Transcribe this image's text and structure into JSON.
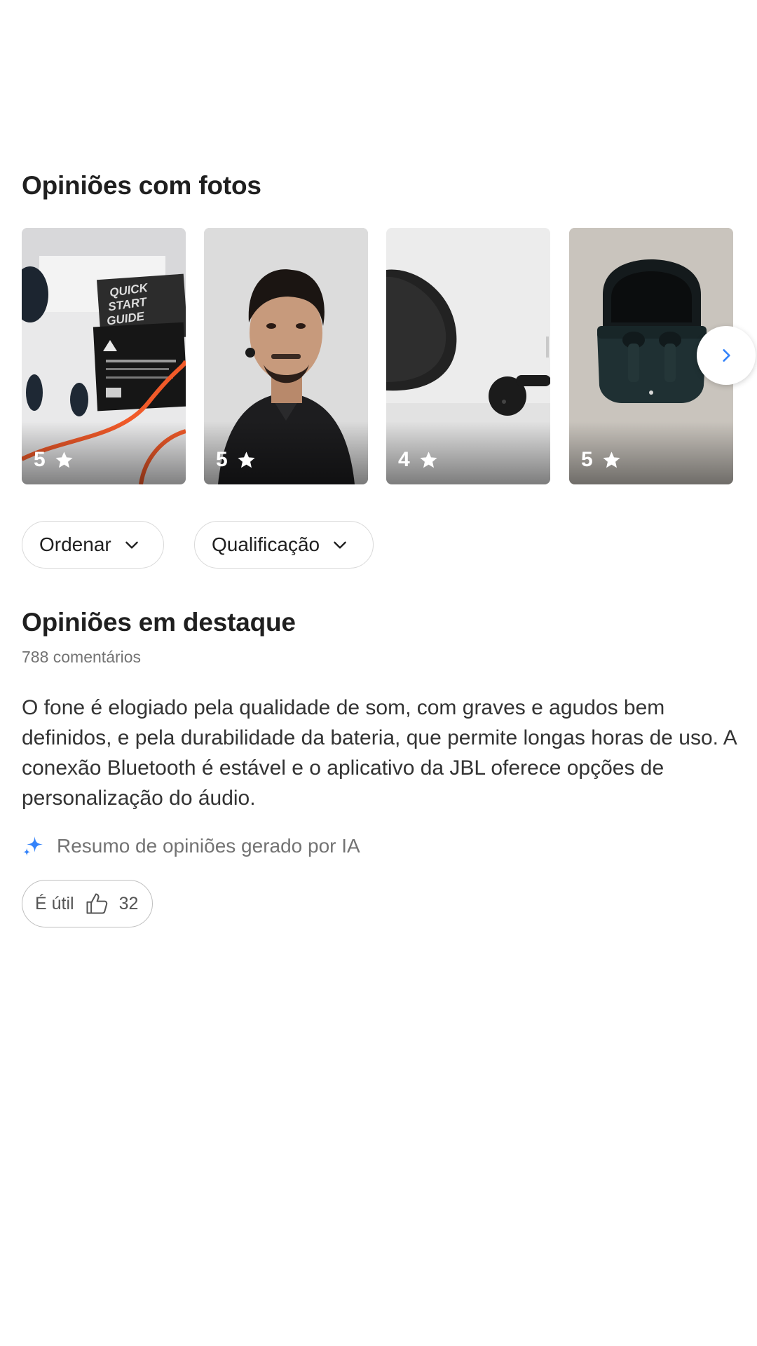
{
  "photos_section": {
    "title": "Opiniões com fotos",
    "photos": [
      {
        "rating": "5",
        "subject": "earbuds with box and quick start guide"
      },
      {
        "rating": "5",
        "subject": "man wearing earbud"
      },
      {
        "rating": "4",
        "subject": "earbud and charging case close-up"
      },
      {
        "rating": "5",
        "subject": "open charging case with earbuds"
      }
    ],
    "next_icon": "chevron-right-icon"
  },
  "filters": {
    "sort_label": "Ordenar",
    "rating_label": "Qualificação"
  },
  "highlights": {
    "title": "Opiniões em destaque",
    "comment_count": "788 comentários",
    "summary": "O fone é elogiado pela qualidade de som, com graves e agudos bem definidos, e pela durabilidade da bateria, que permite longas horas de uso. A conexão Bluetooth é estável e o aplicativo da JBL oferece opções de personalização do áudio.",
    "ai_note": "Resumo de opiniões gerado por IA",
    "helpful_label": "É útil",
    "helpful_count": "32"
  },
  "colors": {
    "accent": "#3483fa",
    "text_primary": "#1f1f1f",
    "text_secondary": "#737373"
  }
}
